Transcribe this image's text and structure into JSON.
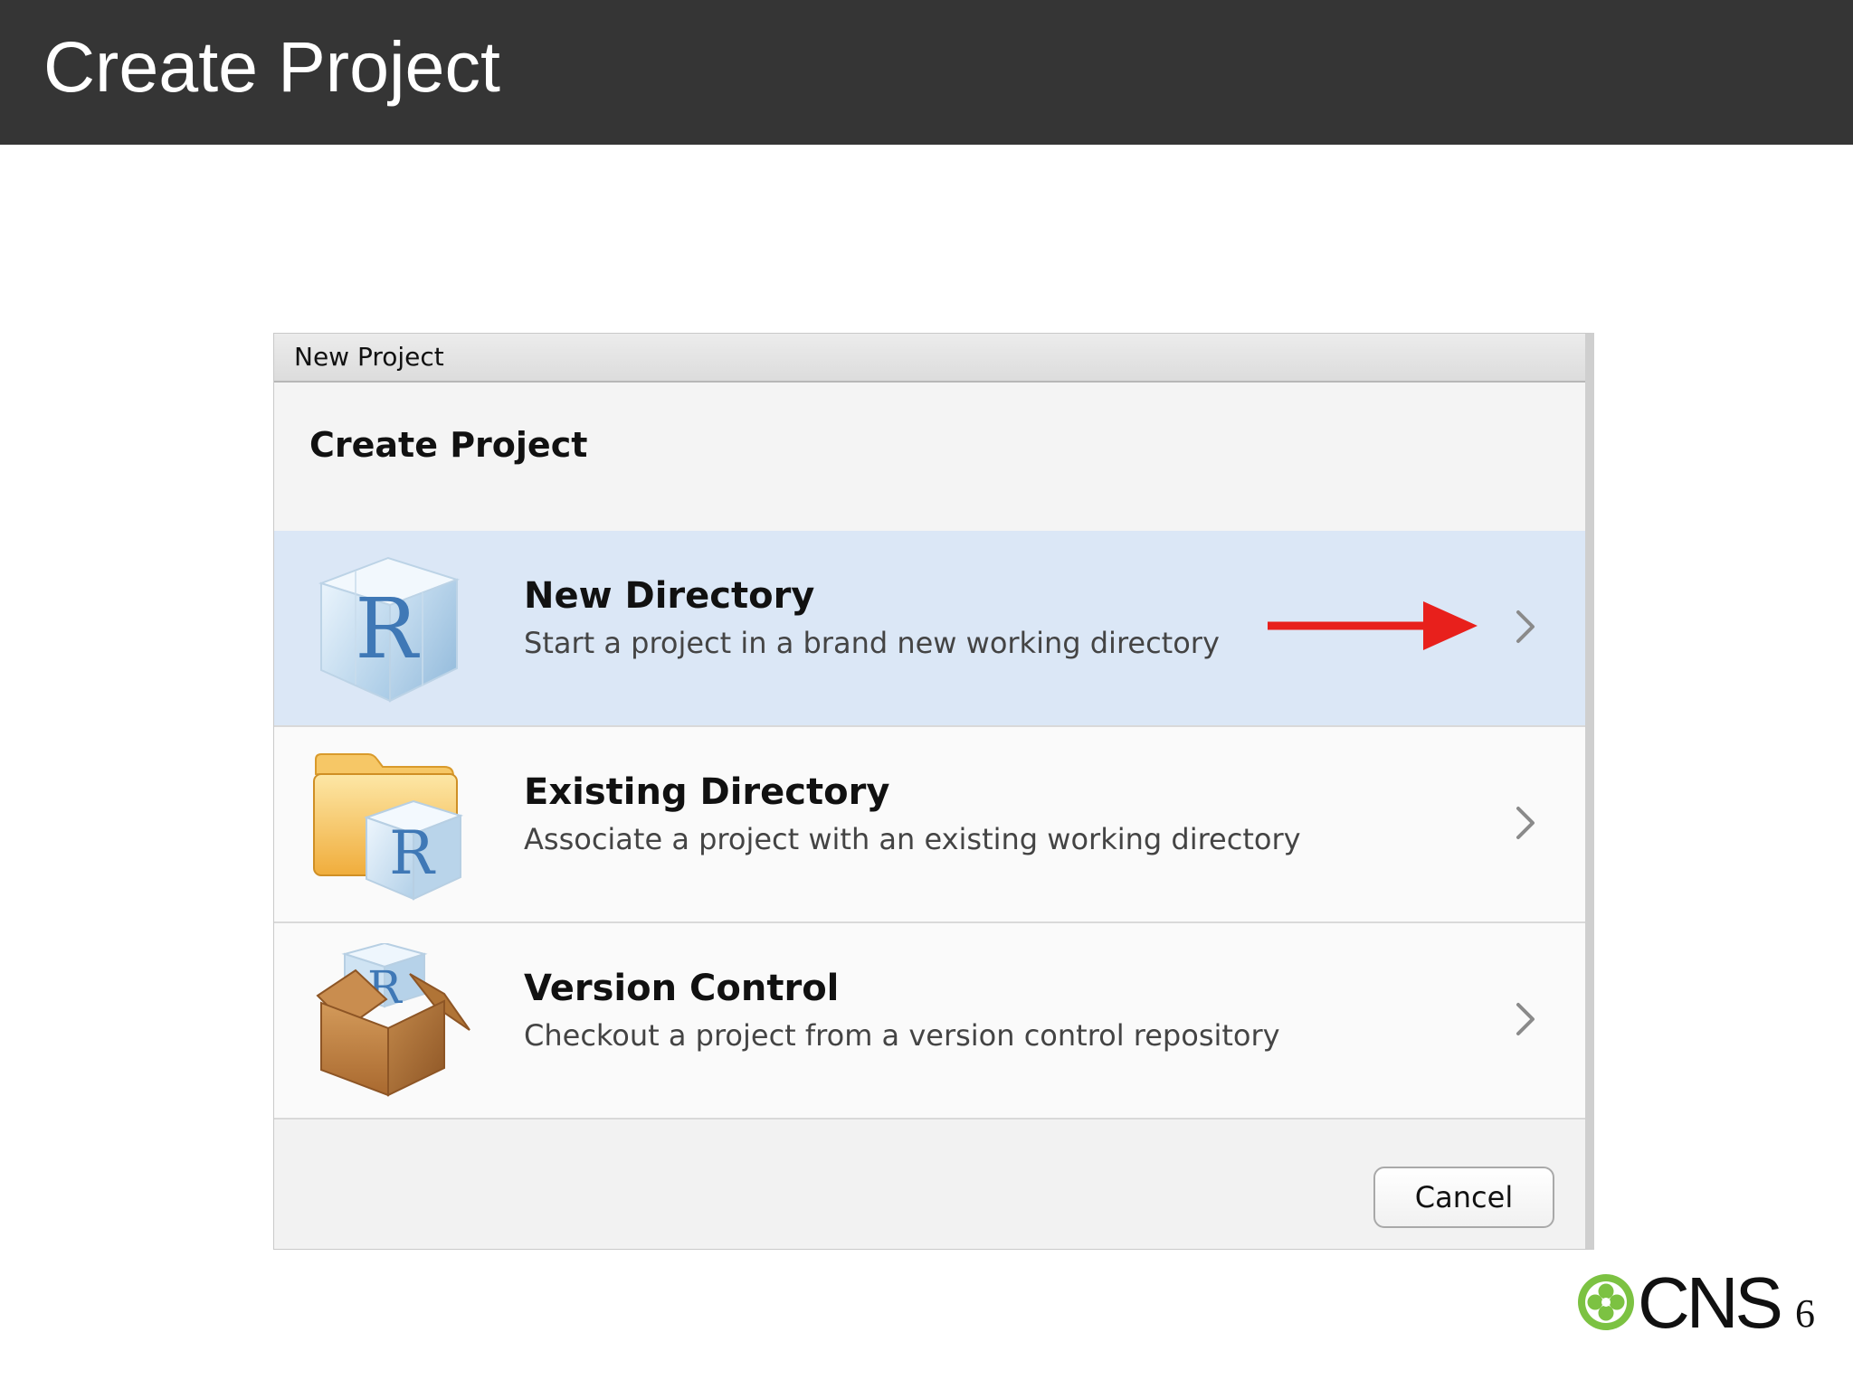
{
  "slide": {
    "title": "Create Project",
    "page_number": "6",
    "logo_text": "CNS"
  },
  "dialog": {
    "window_title": "New Project",
    "heading": "Create Project",
    "options": [
      {
        "title": "New Directory",
        "description": "Start a project in a brand new working directory",
        "icon": "r-cube-icon",
        "selected": true
      },
      {
        "title": "Existing Directory",
        "description": "Associate a project with an existing working directory",
        "icon": "r-folder-icon",
        "selected": false
      },
      {
        "title": "Version Control",
        "description": "Checkout a project from a version control repository",
        "icon": "r-box-icon",
        "selected": false
      }
    ],
    "cancel_label": "Cancel"
  },
  "colors": {
    "header_background": "#353535",
    "selected_row": "#dbe7f6",
    "annotation_arrow": "#e8201c",
    "logo_green": "#7cc242"
  }
}
